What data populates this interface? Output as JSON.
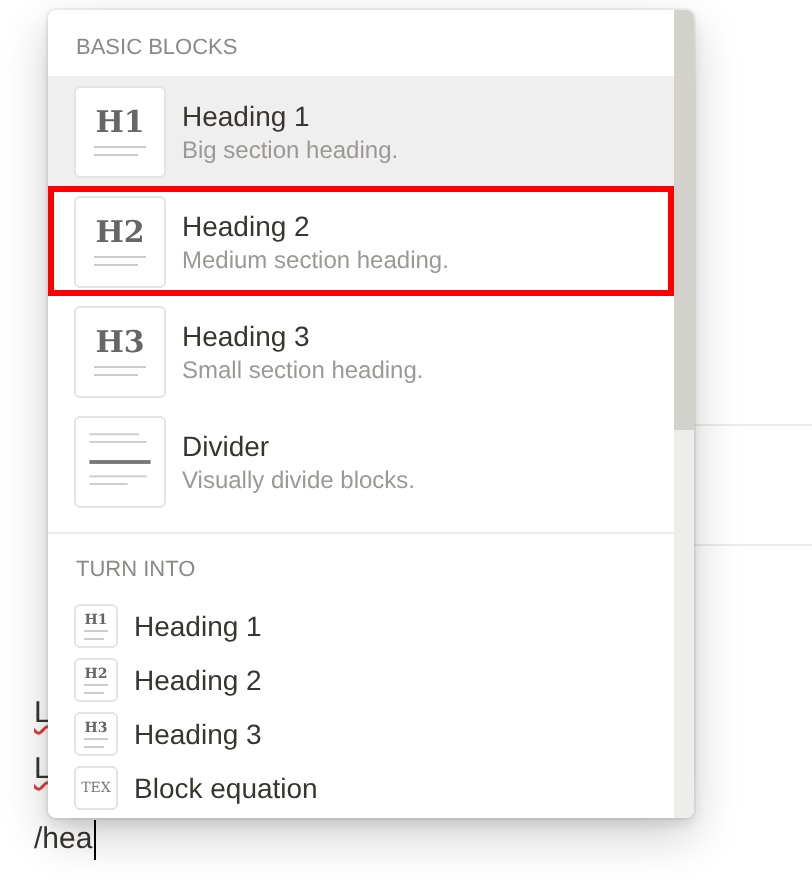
{
  "editor": {
    "lines": [
      {
        "text": "L"
      },
      {
        "text": "L"
      }
    ],
    "typed": "/hea"
  },
  "menu": {
    "sections": [
      {
        "title": "BASIC BLOCKS",
        "kind": "large",
        "items": [
          {
            "kind": "heading",
            "icon_text": "H1",
            "title": "Heading 1",
            "description": "Big section heading.",
            "selected": true,
            "highlighted": false
          },
          {
            "kind": "heading",
            "icon_text": "H2",
            "title": "Heading 2",
            "description": "Medium section heading.",
            "selected": false,
            "highlighted": true
          },
          {
            "kind": "heading",
            "icon_text": "H3",
            "title": "Heading 3",
            "description": "Small section heading.",
            "selected": false,
            "highlighted": false
          },
          {
            "kind": "divider",
            "title": "Divider",
            "description": "Visually divide blocks.",
            "selected": false,
            "highlighted": false
          }
        ]
      },
      {
        "title": "TURN INTO",
        "kind": "small",
        "items": [
          {
            "kind": "heading",
            "icon_text": "H1",
            "title": "Heading 1",
            "selected": false,
            "highlighted": false
          },
          {
            "kind": "heading",
            "icon_text": "H2",
            "title": "Heading 2",
            "selected": false,
            "highlighted": false
          },
          {
            "kind": "heading",
            "icon_text": "H3",
            "title": "Heading 3",
            "selected": false,
            "highlighted": false
          },
          {
            "kind": "equation",
            "icon_text": "TEX",
            "title": "Block equation",
            "selected": false,
            "highlighted": false
          }
        ]
      }
    ]
  }
}
